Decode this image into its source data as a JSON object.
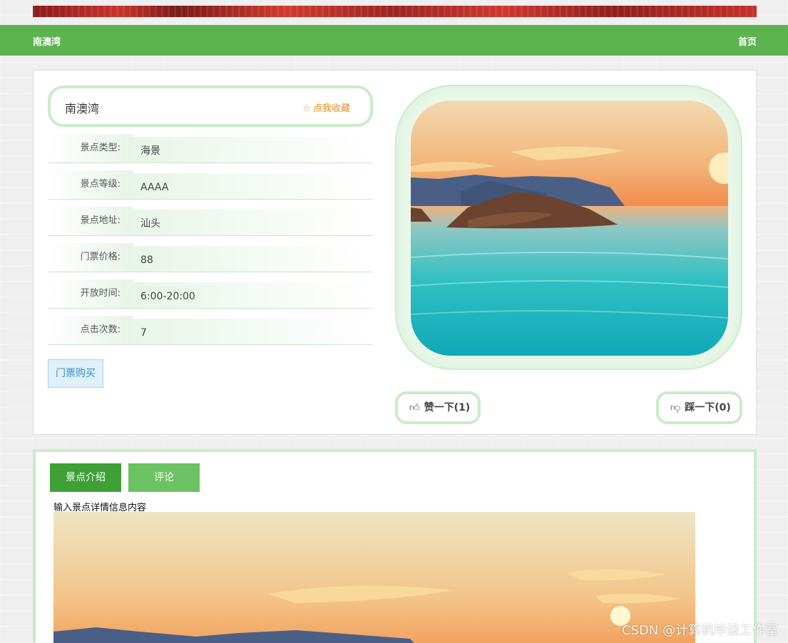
{
  "nav": {
    "brand": "南澳湾",
    "home": "首页"
  },
  "detail": {
    "title": "南澳湾",
    "favorite_label": "点我收藏",
    "fields": [
      {
        "label": "景点类型:",
        "value": "海景"
      },
      {
        "label": "景点等级:",
        "value": "AAAA"
      },
      {
        "label": "景点地址:",
        "value": "汕头"
      },
      {
        "label": "门票价格:",
        "value": "88"
      },
      {
        "label": "开放时间:",
        "value": "6:00-20:00"
      },
      {
        "label": "点击次数:",
        "value": "7"
      }
    ],
    "buy_label": "门票购买",
    "like_label": "赞一下(1)",
    "dislike_label": "踩一下(0)"
  },
  "tabs": {
    "intro": "景点介绍",
    "comment": "评论"
  },
  "intro": {
    "text": "输入景点详情信息内容"
  },
  "watermark": "CSDN @计算机毕设工作室",
  "colors": {
    "nav_green": "#5cb34f",
    "tab_active": "#3ea035",
    "tab_inactive": "#6cc262",
    "frame_green": "#c9ecc9",
    "favorite_orange": "#e58a1f"
  }
}
